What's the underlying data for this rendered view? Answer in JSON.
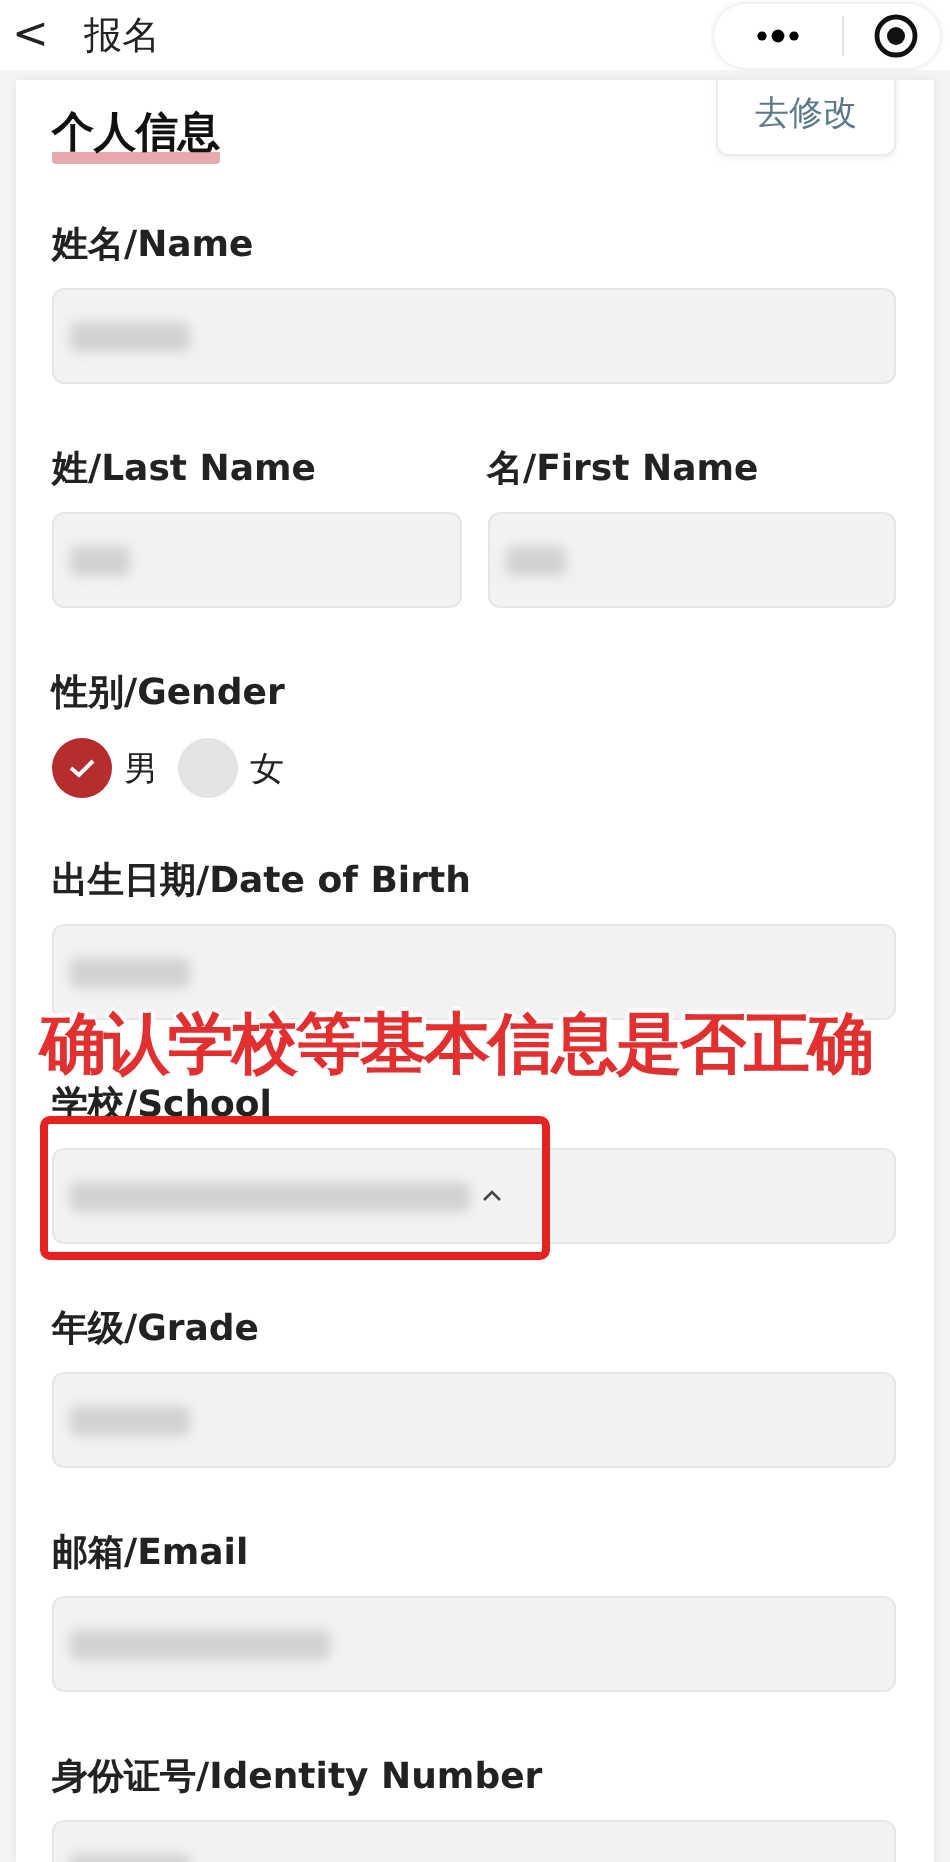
{
  "header": {
    "back": "<",
    "title": "报名"
  },
  "section": {
    "title": "个人信息",
    "edit_button": "去修改"
  },
  "rows": [
    {
      "fields": [
        {
          "label": "姓名/Name",
          "kind": "text",
          "redacted": true
        }
      ]
    },
    {
      "fields": [
        {
          "label": "姓/Last Name",
          "kind": "text",
          "redacted": true
        },
        {
          "label": "名/First Name",
          "kind": "text",
          "redacted": true
        }
      ]
    },
    {
      "fields": [
        {
          "label": "性别/Gender",
          "kind": "radio",
          "options": [
            {
              "label": "男",
              "selected": true
            },
            {
              "label": "女",
              "selected": false
            }
          ]
        }
      ]
    },
    {
      "fields": [
        {
          "label": "出生日期/Date of Birth",
          "kind": "text",
          "redacted": true
        }
      ]
    },
    {
      "fields": [
        {
          "label": "学校/School",
          "kind": "select",
          "redacted": true
        }
      ]
    },
    {
      "fields": [
        {
          "label": "年级/Grade",
          "kind": "text",
          "redacted": true
        }
      ]
    },
    {
      "fields": [
        {
          "label": "邮箱/Email",
          "kind": "text",
          "redacted": true
        }
      ]
    },
    {
      "fields": [
        {
          "label": "身份证号/Identity Number",
          "kind": "text",
          "redacted": true
        }
      ]
    }
  ],
  "annotation": {
    "text": "确认学校等基本信息是否正确",
    "highlight": true
  }
}
